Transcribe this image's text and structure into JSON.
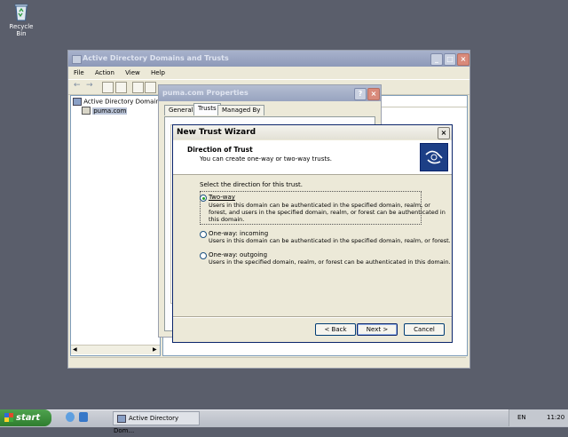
{
  "desktop": {
    "recycle_bin_label": "Recycle Bin"
  },
  "mmc": {
    "title": "Active Directory Domains and Trusts",
    "menu": [
      "File",
      "Action",
      "View",
      "Help"
    ],
    "tree": {
      "root": "Active Directory Domains an",
      "child": "puma.com"
    }
  },
  "properties": {
    "title": "puma.com Properties",
    "tabs": [
      "General",
      "Trusts",
      "Managed By"
    ],
    "selected_tab": "Trusts"
  },
  "wizard": {
    "title": "New Trust Wizard",
    "header_title": "Direction of Trust",
    "header_subtitle": "You can create one-way or two-way trusts.",
    "prompt": "Select the direction for this trust.",
    "options": [
      {
        "label": "Two-way",
        "selected": true,
        "desc_lines": [
          "Users in this domain can be authenticated in the specified domain, realm, or",
          "forest, and users in the specified domain, realm, or forest can be authenticated in",
          "this domain."
        ]
      },
      {
        "label": "One-way: incoming",
        "selected": false,
        "desc_lines": [
          "Users in this domain can be authenticated in the specified domain, realm, or forest."
        ]
      },
      {
        "label": "One-way: outgoing",
        "selected": false,
        "desc_lines": [
          "Users in the specified domain, realm, or forest can be authenticated in this domain."
        ]
      }
    ],
    "buttons": {
      "back": "< Back",
      "next": "Next >",
      "cancel": "Cancel"
    }
  },
  "taskbar": {
    "start_label": "start",
    "task_label": "Active Directory Dom...",
    "language": "EN",
    "clock": "11:20"
  },
  "colors": {
    "desktop_bg": "#5a5e6b",
    "wizard_title_bar": "#0a246a",
    "start_green": "#3a8f3a",
    "close_red": "#d98a7b"
  }
}
